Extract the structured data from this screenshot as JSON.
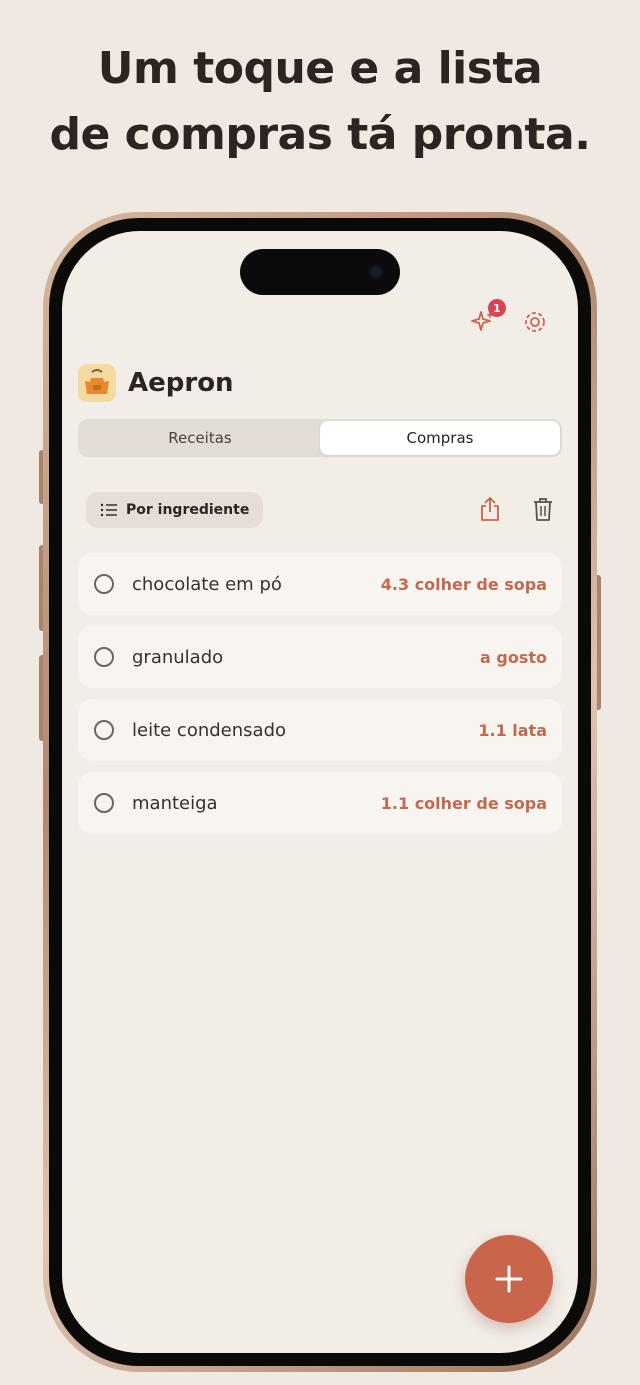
{
  "headline": {
    "line1": "Um toque e a lista",
    "line2": "de compras tá pronta."
  },
  "topbar": {
    "sparkle_badge_count": "1",
    "icons": [
      "sparkle-icon",
      "gear-icon"
    ]
  },
  "app": {
    "title": "Aepron",
    "logo_icon": "apron-icon"
  },
  "tabs": [
    {
      "label": "Receitas",
      "selected": false
    },
    {
      "label": "Compras",
      "selected": true
    }
  ],
  "toolbar": {
    "group_label": "Por ingrediente",
    "icons": [
      "list-icon",
      "share-icon",
      "trash-icon"
    ]
  },
  "shopping_list": [
    {
      "name": "chocolate em pó",
      "quantity": "4.3 colher de sopa"
    },
    {
      "name": "granulado",
      "quantity": "a gosto"
    },
    {
      "name": "leite condensado",
      "quantity": "1.1 lata"
    },
    {
      "name": "manteiga",
      "quantity": "1.1 colher de sopa"
    }
  ],
  "colors": {
    "accent": "#c8654b",
    "background": "#efe9e2",
    "badge": "#d94452"
  }
}
